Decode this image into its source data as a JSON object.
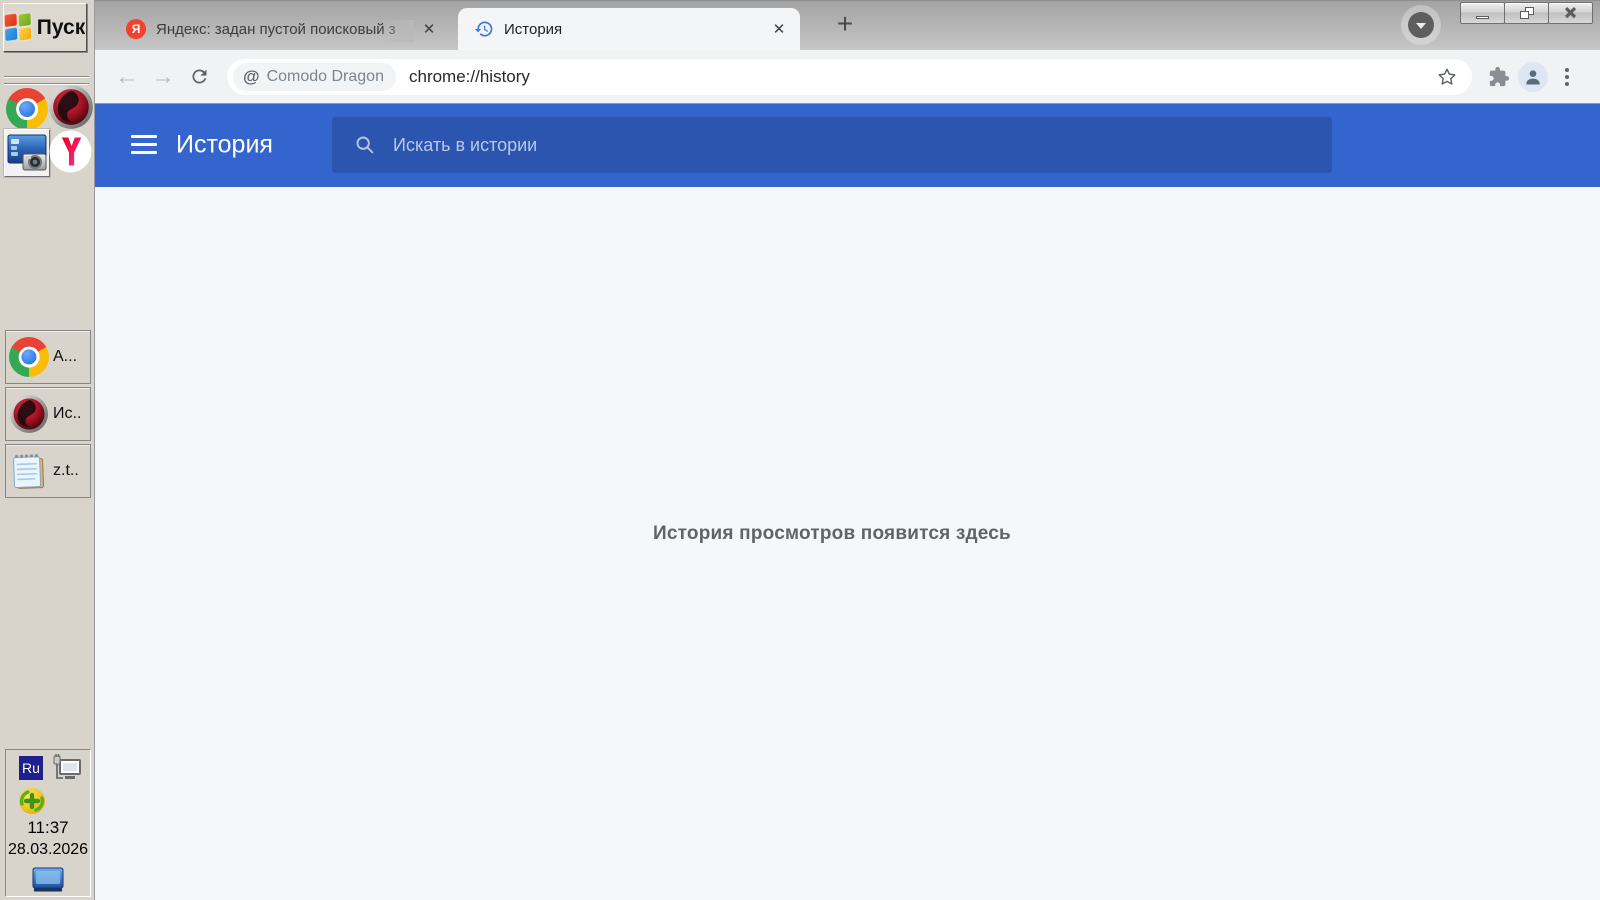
{
  "taskbar": {
    "start": {
      "label": "Пуск"
    },
    "task_buttons": [
      {
        "label": "А...",
        "icon": "chrome"
      },
      {
        "label": "Ис..",
        "icon": "comodo-dragon"
      },
      {
        "label": "z.t..",
        "icon": "notepad"
      }
    ],
    "tray": {
      "language": "Ru",
      "time": "11:37",
      "date": "28.03.2026"
    }
  },
  "browser": {
    "tabs": [
      {
        "title": "Яндекс: задан пустой поисковый з",
        "favicon": "yandex",
        "active": false
      },
      {
        "title": "История",
        "favicon": "history-clock",
        "active": true
      }
    ],
    "new_tab_glyph": "+",
    "close_glyph": "✕",
    "navbar": {
      "site_chip": "Comodo Dragon",
      "chip_icon": "@",
      "url": "chrome://history"
    }
  },
  "history_page": {
    "title": "История",
    "search_placeholder": "Искать в истории",
    "empty_message": "История просмотров появится здесь"
  },
  "colors": {
    "toolbar_blue": "#3465CE",
    "search_blue": "#2B55AF",
    "yandex_red": "#F5402C",
    "content_bg": "#F6F7F9"
  }
}
